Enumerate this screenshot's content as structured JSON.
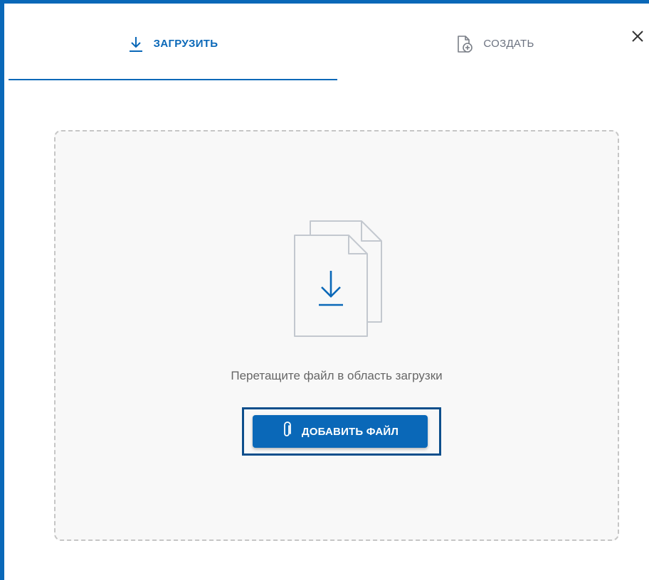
{
  "tabs": [
    {
      "label": "ЗАГРУЗИТЬ",
      "icon": "download-icon",
      "active": true
    },
    {
      "label": "СОЗДАТЬ",
      "icon": "new-document-icon",
      "active": false
    }
  ],
  "close": {
    "icon": "close-icon"
  },
  "dropzone": {
    "illustration_icon": "files-download-icon",
    "hint": "Перетащите файл в область загрузки",
    "button_label": "ДОБАВИТЬ ФАЙЛ",
    "button_icon": "paperclip-icon"
  },
  "colors": {
    "accent": "#0a68b8",
    "muted_text": "#6b7280",
    "dropzone_bg": "#f8f8f8",
    "dashed_border": "#c6c6c6"
  }
}
